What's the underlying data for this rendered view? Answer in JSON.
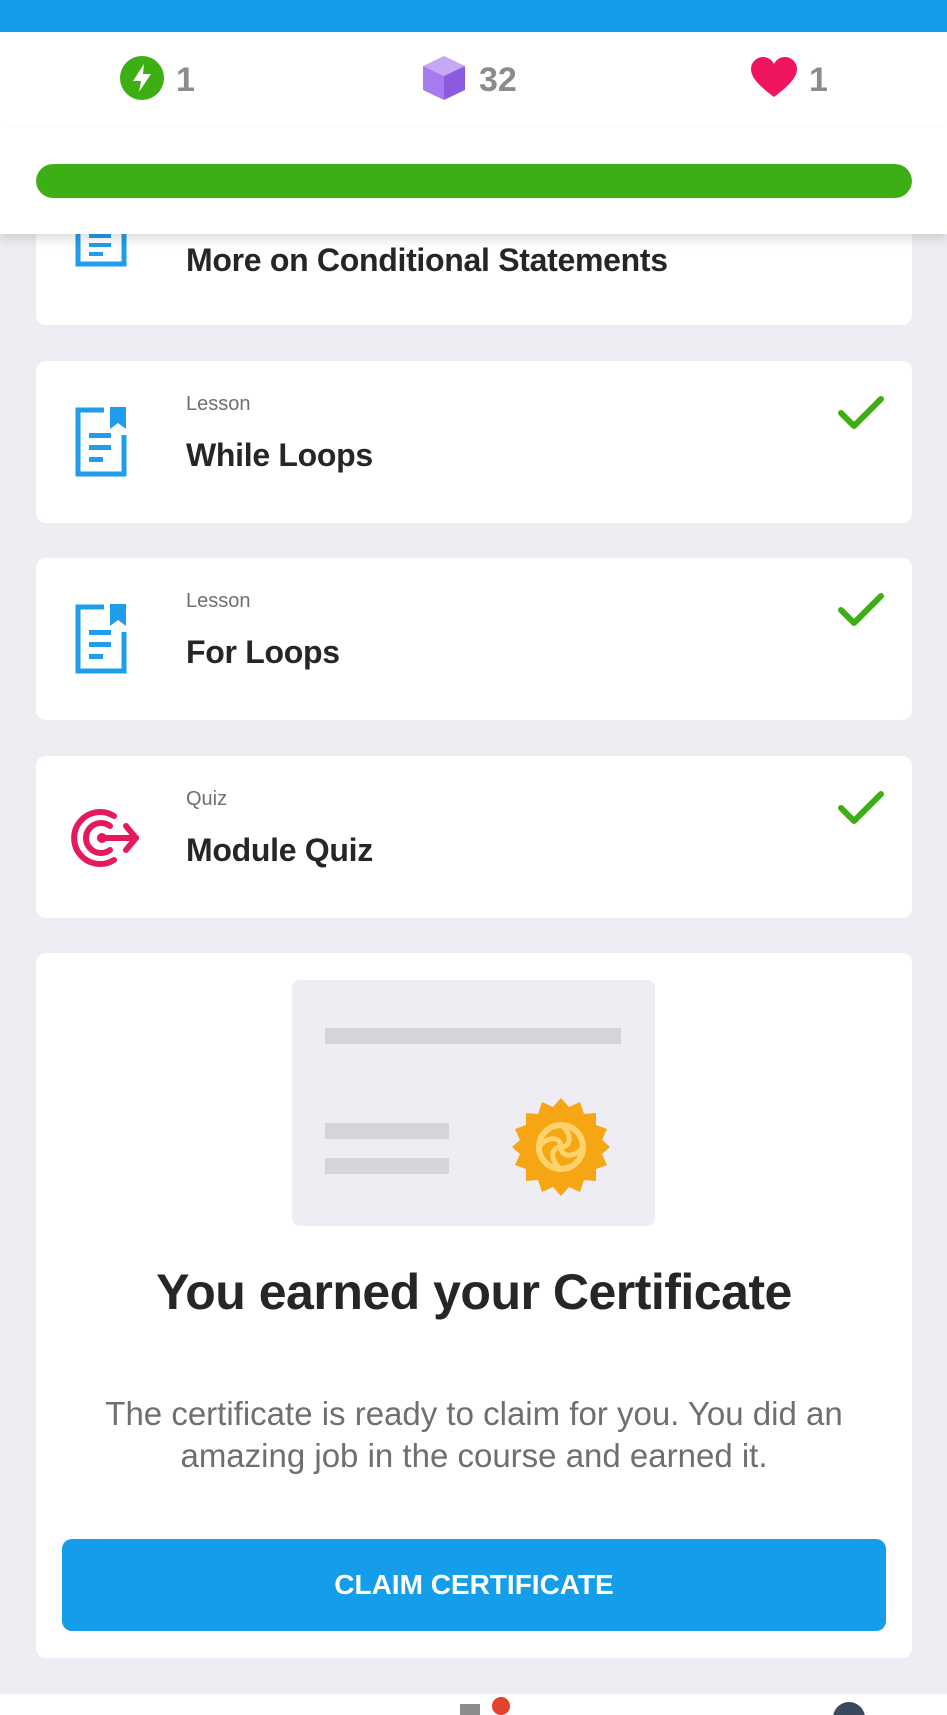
{
  "header": {
    "partial_title": ""
  },
  "stats": {
    "energy": {
      "icon": "lightning-icon",
      "value": "1",
      "color": "#3DAE14"
    },
    "gems": {
      "icon": "cube-icon",
      "value": "32",
      "color": "#9A6BE8"
    },
    "lives": {
      "icon": "heart-icon",
      "value": "1",
      "color": "#F0155F"
    }
  },
  "progress": {
    "fraction": 1.0,
    "color": "#3DAE14"
  },
  "items": [
    {
      "kind": "",
      "title": "More on Conditional Statements",
      "icon": "lesson-icon",
      "completed": false
    },
    {
      "kind": "Lesson",
      "title": "While Loops",
      "icon": "lesson-icon",
      "completed": true
    },
    {
      "kind": "Lesson",
      "title": "For Loops",
      "icon": "lesson-icon",
      "completed": true
    },
    {
      "kind": "Quiz",
      "title": "Module Quiz",
      "icon": "target-icon",
      "completed": true
    }
  ],
  "certificate": {
    "title": "You earned your Certificate",
    "description": "The certificate is ready to claim for you. You did an amazing job in the course and earned it.",
    "button_label": "CLAIM CERTIFICATE",
    "seal_color": "#F6A515"
  },
  "colors": {
    "accent": "#149EEA",
    "success": "#3DAE14",
    "background": "#EDEDF3"
  }
}
